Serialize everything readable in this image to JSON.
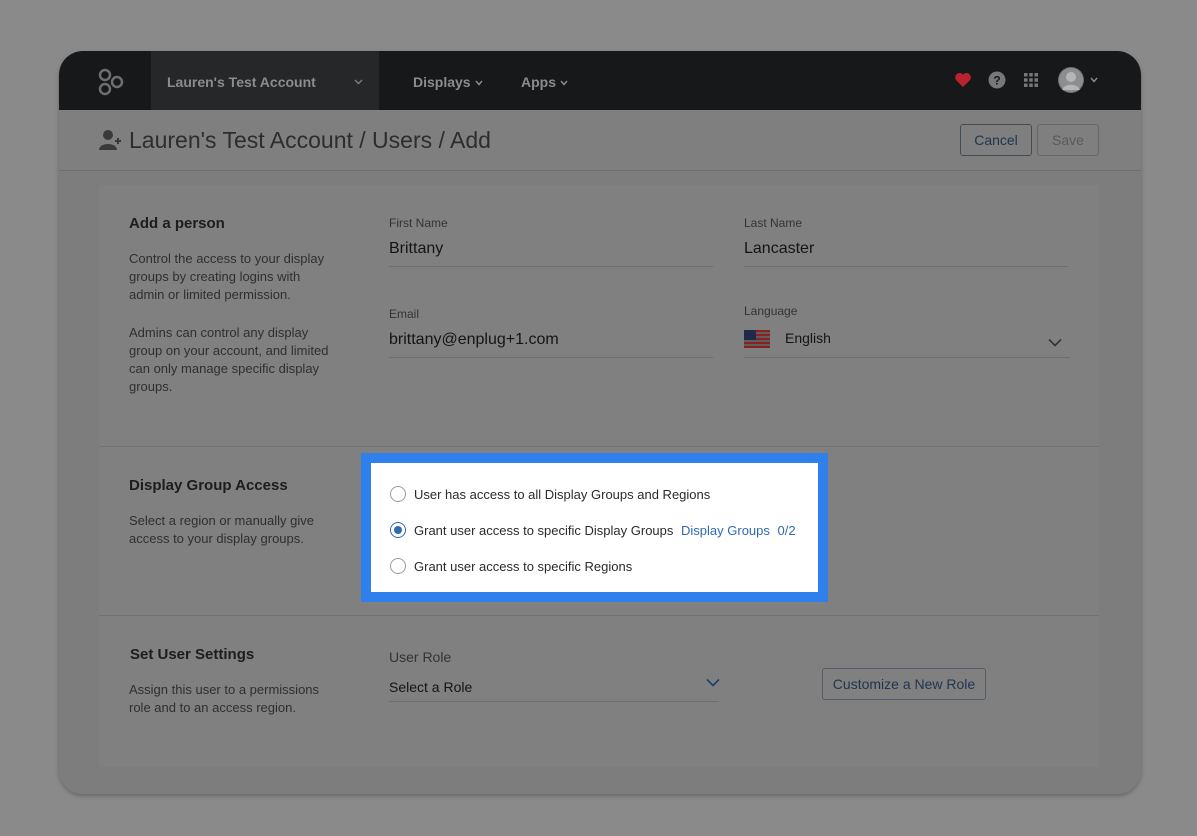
{
  "nav": {
    "account": "Lauren's Test Account",
    "displays": "Displays",
    "apps": "Apps",
    "icons": [
      "logo-icon",
      "heart-icon",
      "help-icon",
      "apps-grid-icon",
      "avatar"
    ]
  },
  "header": {
    "breadcrumb": "Lauren's Test Account / Users / Add",
    "cancel": "Cancel",
    "save": "Save"
  },
  "add_person": {
    "title": "Add a person",
    "desc1": "Control the access to your display groups by creating logins with admin or limited permission.",
    "desc2": "Admins can control any display group on your account, and limited can only manage specific display groups.",
    "first_name_label": "First Name",
    "first_name": "Brittany",
    "last_name_label": "Last Name",
    "last_name": "Lancaster",
    "email_label": "Email",
    "email": "brittany@enplug+1.com",
    "language_label": "Language",
    "language": "English"
  },
  "access": {
    "title": "Display Group Access",
    "desc": "Select a region or manually give access to your display groups.",
    "option_all": "User has access to all Display Groups and Regions",
    "option_groups": "Grant user access to specific Display Groups",
    "groups_link": "Display Groups",
    "groups_count": "0/2",
    "option_regions": "Grant user access to specific Regions",
    "selected": "option_groups"
  },
  "settings": {
    "title": "Set User Settings",
    "desc": "Assign this user to a permissions role and to an access region.",
    "role_label": "User Role",
    "role_placeholder": "Select a Role",
    "customize": "Customize a New Role"
  },
  "colors": {
    "nav_bg": "#17181a",
    "highlight": "#2f80ed",
    "accent": "#2f6ab3",
    "heart": "#b8232f"
  }
}
